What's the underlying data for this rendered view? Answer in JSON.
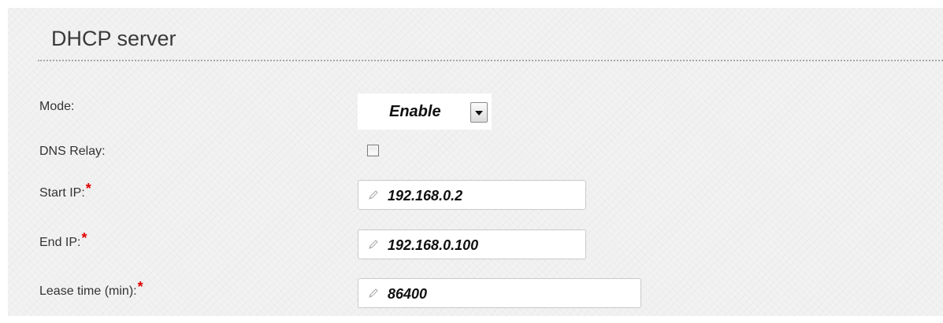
{
  "section": {
    "title": "DHCP server"
  },
  "fields": {
    "mode": {
      "label": "Mode:",
      "value": "Enable"
    },
    "dns_relay": {
      "label": "DNS Relay:",
      "checked": false
    },
    "start_ip": {
      "label": "Start IP:",
      "required_mark": "*",
      "value": "192.168.0.2"
    },
    "end_ip": {
      "label": "End IP:",
      "required_mark": "*",
      "value": "192.168.0.100"
    },
    "lease_time": {
      "label": "Lease time (min):",
      "required_mark": "*",
      "value": "86400"
    }
  },
  "colors": {
    "panel_background": "#f0f0f0",
    "required_mark": "#e00000",
    "text": "#333333"
  },
  "icons": {
    "select_arrow": "chevron-down-icon",
    "input_edit": "pencil-icon"
  }
}
